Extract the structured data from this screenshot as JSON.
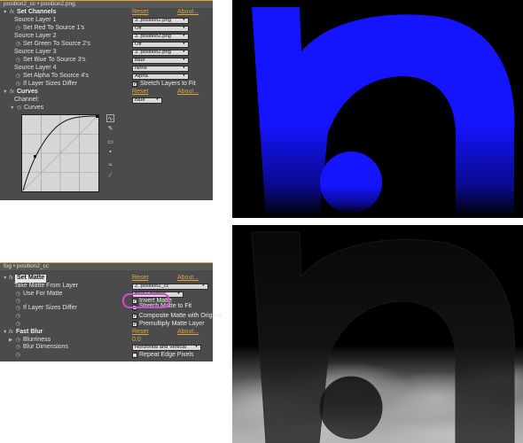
{
  "panel1": {
    "tab": "position2_cc • position2.png",
    "set_channels": {
      "fx": "fx",
      "title": "Set Channels",
      "reset": "Reset",
      "about": "About...",
      "rows": [
        {
          "label": "Source Layer 1",
          "value": "3. position2.png"
        },
        {
          "label": "Set Red To Source 1's",
          "value": "Off"
        },
        {
          "label": "Source Layer 2",
          "value": "3. position2.png"
        },
        {
          "label": "Set Green To Source 2's",
          "value": "Off"
        },
        {
          "label": "Source Layer 3",
          "value": "3. position2.png"
        },
        {
          "label": "Set Blue To Source 3's",
          "value": "Blue"
        },
        {
          "label": "Source Layer 4",
          "value": "None"
        },
        {
          "label": "Set Alpha To Source 4's",
          "value": "Alpha"
        }
      ],
      "if_sizes_label": "If Layer Sizes Differ",
      "stretch_label": "Stretch Layers to Fit"
    },
    "curves": {
      "fx": "fx",
      "title": "Curves",
      "reset": "Reset",
      "about": "About...",
      "channel_label": "Channel:",
      "channel_value": "Blue",
      "curves_label": "Curves"
    }
  },
  "panel2": {
    "tab": "fog • position2_cc",
    "set_matte": {
      "fx": "fx",
      "title": "Set Matte",
      "reset": "Reset",
      "about": "About...",
      "take_matte_label": "Take Matte From Layer",
      "take_matte_value": "2. position2_cc",
      "use_for_matte_label": "Use For Matte",
      "use_for_matte_value": "Blue Channel",
      "invert_matte": "Invert Matte",
      "if_sizes_label": "If Layer Sizes Differ",
      "stretch_matte": "Stretch Matte to Fit",
      "composite": "Composite Matte with Original",
      "premultiply": "Premultiply Matte Layer"
    },
    "fast_blur": {
      "fx": "fx",
      "title": "Fast Blur",
      "reset": "Reset",
      "about": "About...",
      "blurriness_label": "Blurriness",
      "blurriness_value": "0.0",
      "dimensions_label": "Blur Dimensions",
      "dimensions_value": "Horizontal and Vertical",
      "repeat_edge": "Repeat Edge Pixels"
    }
  },
  "colors": {
    "panel_bg": "#4b4b4b",
    "accent_orange": "#e3a53b",
    "matte_blue": "#1414ff",
    "highlight_magenta": "#d24ad4"
  }
}
